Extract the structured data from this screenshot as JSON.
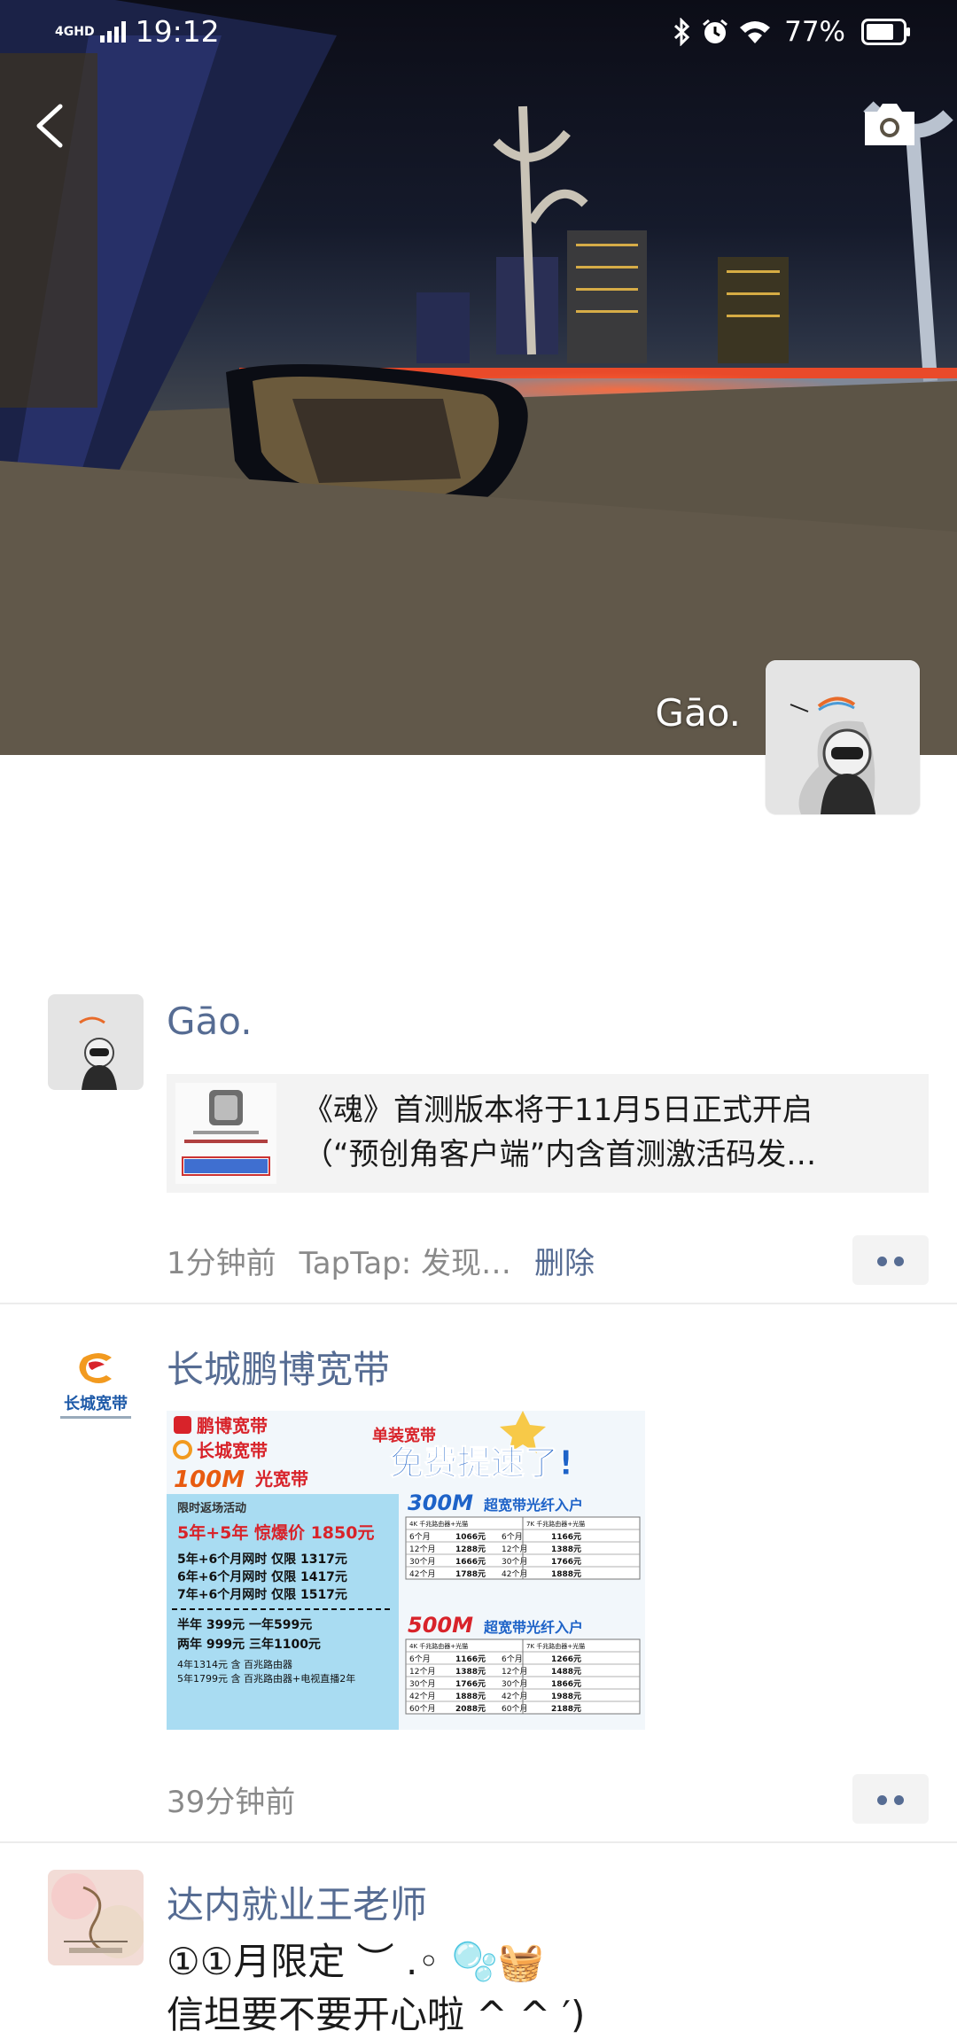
{
  "status_bar": {
    "network": "4GHD",
    "time": "19:12",
    "battery": "77%"
  },
  "icons": {
    "back": "chevron-left-icon",
    "camera": "camera-icon",
    "bluetooth": "bluetooth-icon",
    "alarm": "alarm-icon",
    "wifi": "wifi-icon",
    "battery": "battery-icon",
    "more": "more-dots-icon"
  },
  "cover": {
    "owner_name": "Gāo."
  },
  "posts": [
    {
      "author": "Gāo.",
      "link_line1": "《魂》首测版本将于11月5日正式开启",
      "link_line2": "（“预创角客户端”内含首测激活码发…",
      "time": "1分钟前",
      "source": "TapTap: 发现…",
      "delete_label": "删除"
    },
    {
      "author": "长城鹏博宽带",
      "time": "39分钟前",
      "ad": {
        "brand1": "鹏博宽带",
        "brand2": "长城宽带",
        "promo_tag": "单装宽带",
        "headline": "免费提速了!",
        "speed100": "100M",
        "speed100_label": "光宽带",
        "limited": "限时返场活动",
        "deal_main": "5年+5年 惊爆价 1850元",
        "deal_lines": [
          "5年+6个月网时 仅限 1317元",
          "6年+6个月网时 仅限 1417元",
          "7年+6个月网时 仅限 1517元"
        ],
        "deal_short1": "半年 399元   一年599元",
        "deal_short2": "两年 999元   三年1100元",
        "deal_small1": "4年1314元 含 百兆路由器",
        "deal_small2": "5年1799元 含 百兆路由器+电视直播2年",
        "speed300": "300M",
        "speed300_label": "超宽带光纤入户",
        "speed500": "500M",
        "speed500_label": "超宽带光纤入户",
        "table_head_a": "4K 千兆路由器+光猫",
        "table_head_b": "7K 千兆路由器+光猫",
        "table300": [
          [
            "6个月",
            "1066元",
            "6个月",
            "1166元"
          ],
          [
            "12个月",
            "1288元",
            "12个月",
            "1388元"
          ],
          [
            "30个月",
            "1666元",
            "30个月",
            "1766元"
          ],
          [
            "42个月",
            "1788元",
            "42个月",
            "1888元"
          ]
        ],
        "table500": [
          [
            "6个月",
            "1166元",
            "6个月",
            "1266元"
          ],
          [
            "12个月",
            "1388元",
            "12个月",
            "1488元"
          ],
          [
            "30个月",
            "1766元",
            "30个月",
            "1866元"
          ],
          [
            "42个月",
            "1888元",
            "42个月",
            "1988元"
          ],
          [
            "60个月",
            "2088元",
            "60个月",
            "2188元"
          ]
        ]
      }
    },
    {
      "author": "达内就业王老师",
      "text_line1": "①①月限定 ︶ .◦ 🫧🧺",
      "text_line2": "信坦要不要开心啦 ^ ^ ′)"
    }
  ]
}
